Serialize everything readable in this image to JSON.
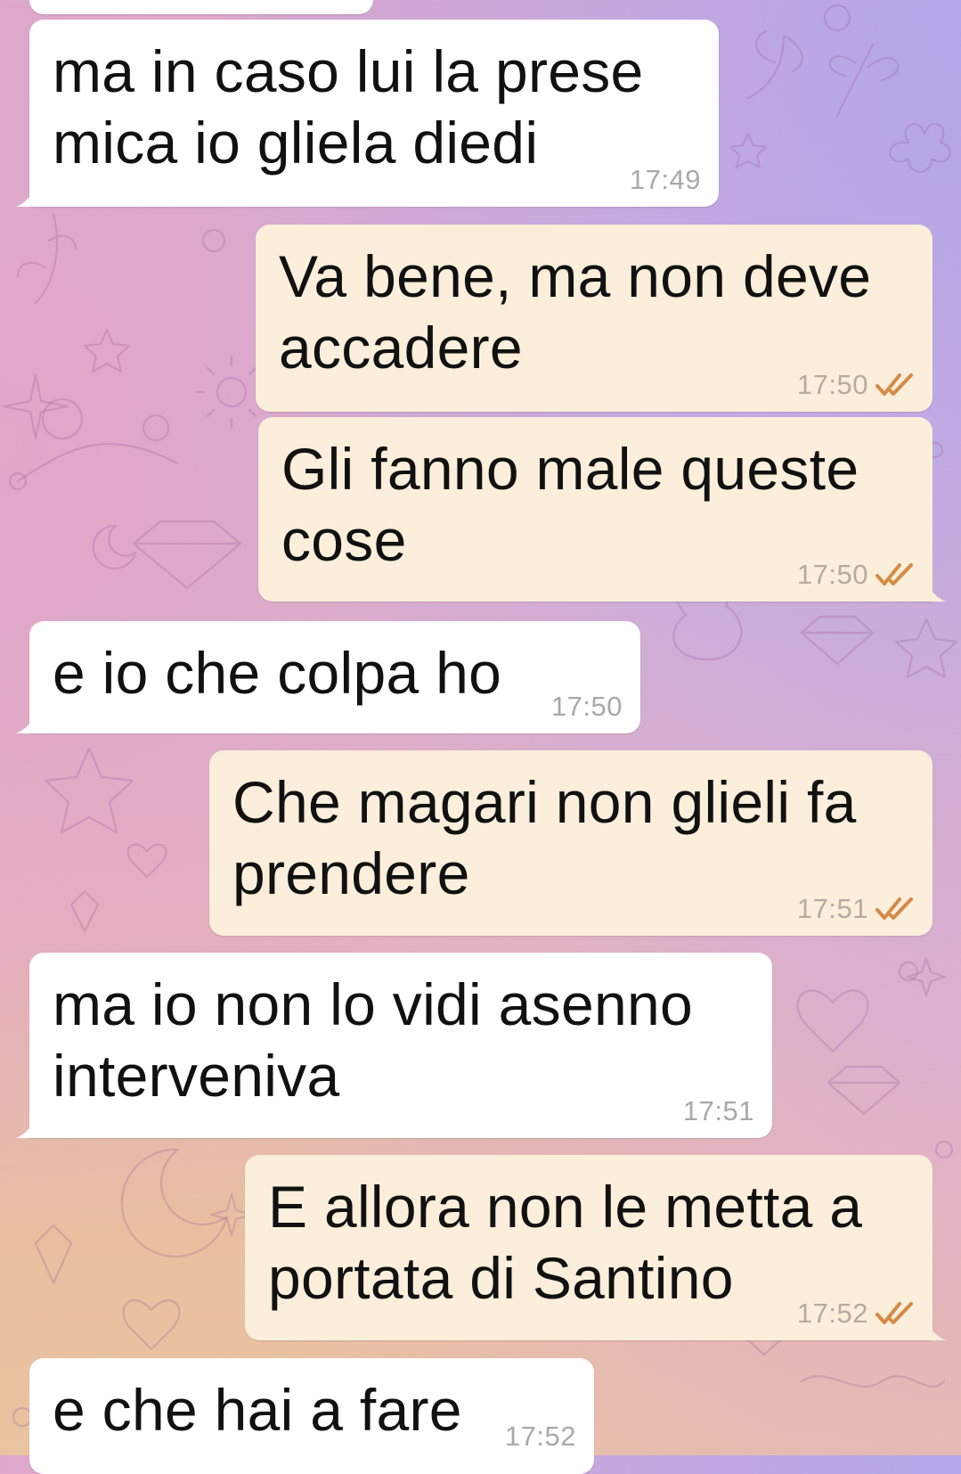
{
  "chat": {
    "messages": [
      {
        "direction": "in",
        "text": "",
        "time": ""
      },
      {
        "direction": "in",
        "lines": [
          "ma in caso lui la prese",
          "mica io gliela diedi"
        ],
        "time": "17:49"
      },
      {
        "direction": "out",
        "lines": [
          "Va bene, ma non deve",
          "accadere"
        ],
        "time": "17:50",
        "status": "read-ticks-icon"
      },
      {
        "direction": "out",
        "lines": [
          "Gli fanno male queste",
          "cose"
        ],
        "time": "17:50",
        "status": "read-ticks-icon"
      },
      {
        "direction": "in",
        "lines": [
          "e io che colpa ho"
        ],
        "time": "17:50"
      },
      {
        "direction": "out",
        "lines": [
          "Che magari non glieli fa",
          "prendere"
        ],
        "time": "17:51",
        "status": "read-ticks-icon"
      },
      {
        "direction": "in",
        "lines": [
          "ma io non lo vidi asenno",
          "interveniva"
        ],
        "time": "17:51"
      },
      {
        "direction": "out",
        "lines": [
          "E allora non le metta a",
          "portata di Santino"
        ],
        "time": "17:52",
        "status": "read-ticks-icon"
      },
      {
        "direction": "in",
        "lines": [
          "e che hai a fare"
        ],
        "time": "17:52"
      }
    ]
  },
  "colors": {
    "incoming_bubble": "#ffffff",
    "outgoing_bubble": "#fbeedb",
    "read_ticks": "#d58a45",
    "timestamp": "#a9a9a9"
  }
}
